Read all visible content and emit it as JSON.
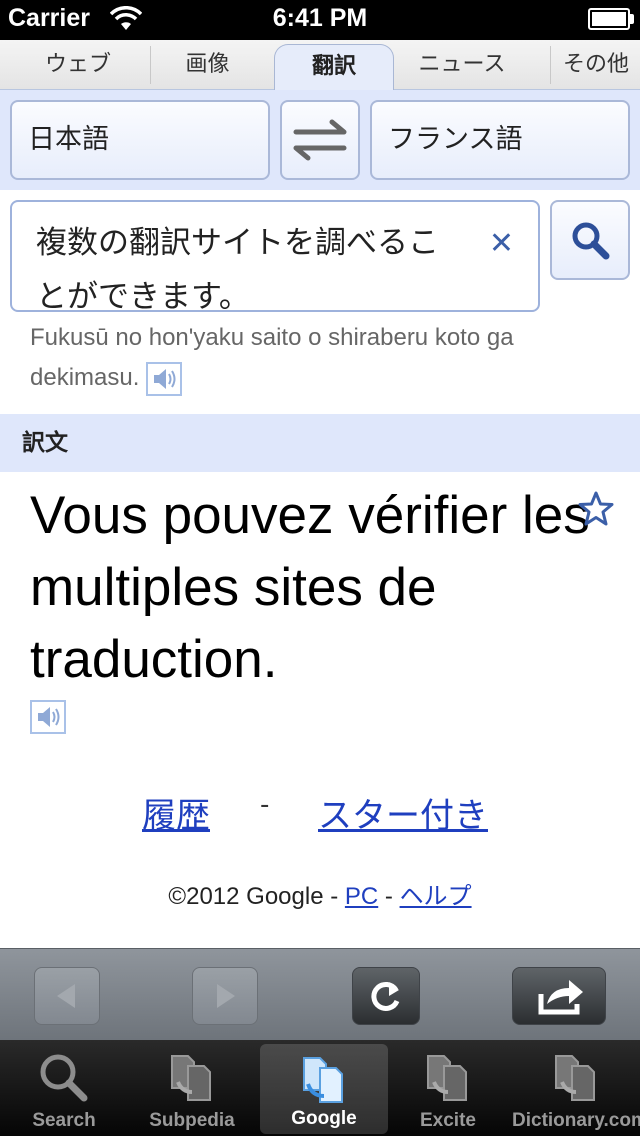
{
  "status_bar": {
    "carrier": "Carrier",
    "time": "6:41 PM"
  },
  "tabs": [
    {
      "label": "ウェブ"
    },
    {
      "label": "画像"
    },
    {
      "label": "翻訳",
      "active": true
    },
    {
      "label": "ニュース"
    },
    {
      "label": "その他"
    }
  ],
  "languages": {
    "source": "日本語",
    "target": "フランス語"
  },
  "input": {
    "value": "複数の翻訳サイトを調べることができます。"
  },
  "romanization": "Fukusū no hon'yaku saito o shiraberu koto ga dekimasu.",
  "section_label": "訳文",
  "translation": "Vous pouvez vérifier les multiples sites de traduction.",
  "links": {
    "history": "履歴",
    "separator": "-",
    "starred": "スター付き"
  },
  "footer": {
    "copyright": "©2012 Google - ",
    "pc": "PC",
    "sep": " - ",
    "help": "ヘルプ"
  },
  "tabbar": {
    "items": [
      {
        "label": "Search"
      },
      {
        "label": "Subpedia"
      },
      {
        "label": "Google",
        "active": true
      },
      {
        "label": "Excite"
      },
      {
        "label": "Dictionary.com"
      }
    ]
  },
  "colors": {
    "accent": "#1f3fbf",
    "panel": "#dfe7fb",
    "icon_blue": "#3b5fa8"
  }
}
